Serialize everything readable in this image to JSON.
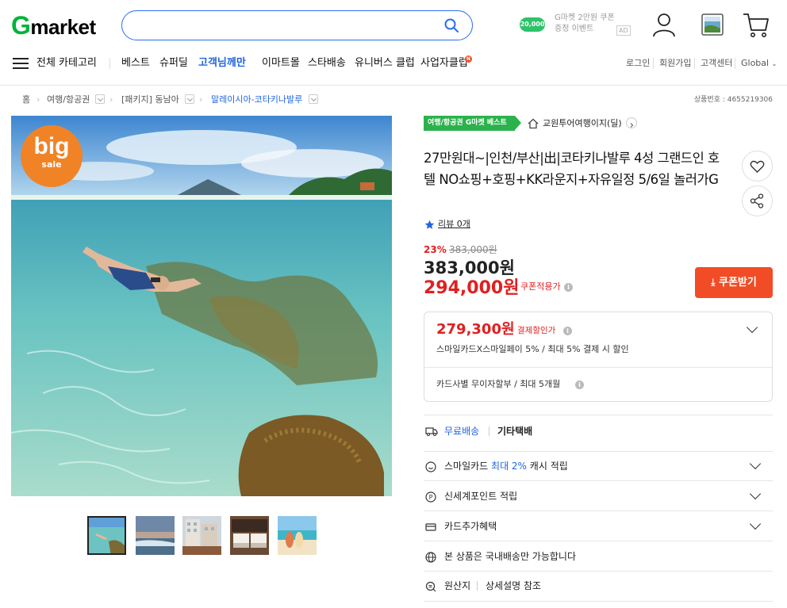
{
  "header": {
    "logo_g": "G",
    "logo_rest": "market",
    "search_placeholder": "",
    "ad_coin": "20,000",
    "ad_text_line1": "G마켓 2만원 쿠폰",
    "ad_text_line2": "증정 이벤트",
    "ad_tag": "AD"
  },
  "nav": {
    "all_categories": "전체 카테고리",
    "items": [
      "베스트",
      "슈퍼딜",
      "고객님께만",
      "이마트몰",
      "스타배송",
      "유니버스 클럽",
      "사업자클럽"
    ],
    "new_badge": "N",
    "utility": [
      "로그인",
      "회원가입",
      "고객센터",
      "Global"
    ]
  },
  "breadcrumb": {
    "home": "홈",
    "level1": "여행/항공권",
    "level2": "[패키지] 동남아",
    "level3": "말레이시아-코타키나발루",
    "product_no": "상품번호 : 4655219306"
  },
  "image": {
    "badge_big": "big",
    "badge_sale": "sale"
  },
  "product": {
    "best_badge": "여행/항공권 G마켓 베스트",
    "seller": "교원투어여행이지(딜)",
    "title": "27만원대~|인천/부산|出|코타키나발루 4성 그랜드인 호텔 NO쇼핑+호핑+KK라운지+자유일정 5/6일 놀러가G",
    "review": "리뷰 0개",
    "discount_rate": "23%",
    "original_price": "383,000원",
    "price": "383,000원",
    "coupon_price": "294,000원",
    "coupon_note": "쿠폰적용가",
    "coupon_button": "쿠폰받기",
    "pay_price": "279,300원",
    "pay_note": "결제할인가",
    "pay_desc": "스마일카드X스마일페이 5% / 최대 5% 결제 시 할인",
    "installment": "카드사별 무이자할부 / 최대 5개월",
    "shipping_free": "무료배송",
    "shipping_type": "기타택배",
    "smile_card_pre": "스마일카드",
    "smile_card_max": "최대 2%",
    "smile_card_post": "캐시 적립",
    "shinsegae": "신세계포인트 적립",
    "card_benefit": "카드추가혜택",
    "domestic": "본 상품은 국내배송만 가능합니다",
    "origin": "원산지",
    "origin_value": "상세설명 참조"
  },
  "colors": {
    "brand_green": "#00b33c",
    "accent_blue": "#2065e0",
    "price_red": "#e02020",
    "coupon_orange": "#f14c25"
  }
}
